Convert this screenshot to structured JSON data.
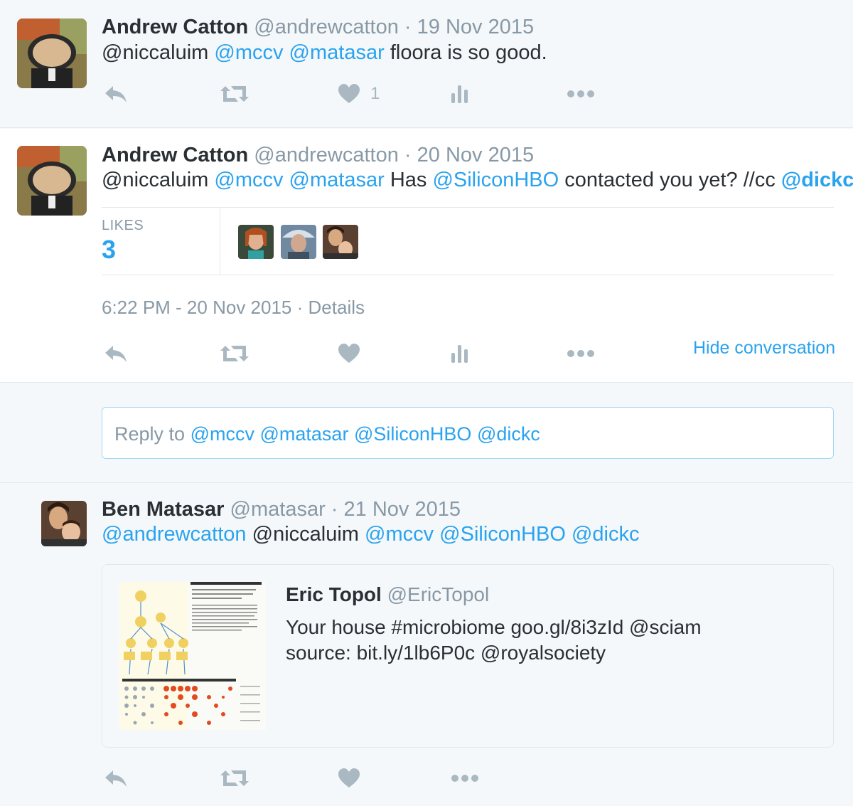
{
  "tweets": [
    {
      "name": "Andrew Catton",
      "handle": "@andrewcatton",
      "sep": "·",
      "date": "19 Nov 2015",
      "text_parts": [
        "@niccaluim",
        "@mccv",
        "@matasar",
        "floora is so good."
      ],
      "like_count": "1"
    },
    {
      "name": "Andrew Catton",
      "handle": "@andrewcatton",
      "sep": "·",
      "date": "20 Nov 2015",
      "text_parts": [
        "@niccaluim",
        "@mccv",
        "@matasar",
        "Has",
        "@SiliconHBO",
        "contacted you yet? //cc",
        "@dickc"
      ],
      "likes_label": "LIKES",
      "likes_count": "3",
      "timestamp": "6:22 PM - 20 Nov 2015",
      "details_sep": "·",
      "details_label": "Details",
      "hide_conversation": "Hide conversation"
    },
    {
      "name": "Ben Matasar",
      "handle": "@matasar",
      "sep": "·",
      "date": "21 Nov 2015",
      "text_parts": [
        "@andrewcatton",
        "@niccaluim",
        "@mccv",
        "@SiliconHBO",
        "@dickc"
      ]
    }
  ],
  "reply_box": {
    "prefix": "Reply to",
    "mentions": [
      "@mccv",
      "@matasar",
      "@SiliconHBO",
      "@dickc"
    ]
  },
  "quoted": {
    "name": "Eric Topol",
    "handle": "@EricTopol",
    "line1": "Your house #microbiome goo.gl/8i3zId @sciam",
    "line2": "source: bit.ly/1lb6P0c @royalsociety"
  },
  "icons": {
    "reply": "reply-icon",
    "retweet": "retweet-icon",
    "like": "heart-icon",
    "analytics": "analytics-icon",
    "more": "more-icon"
  },
  "colors": {
    "link": "#2aa3ef",
    "muted": "#8899a6",
    "icon": "#aab8c2",
    "text": "#292f33"
  }
}
